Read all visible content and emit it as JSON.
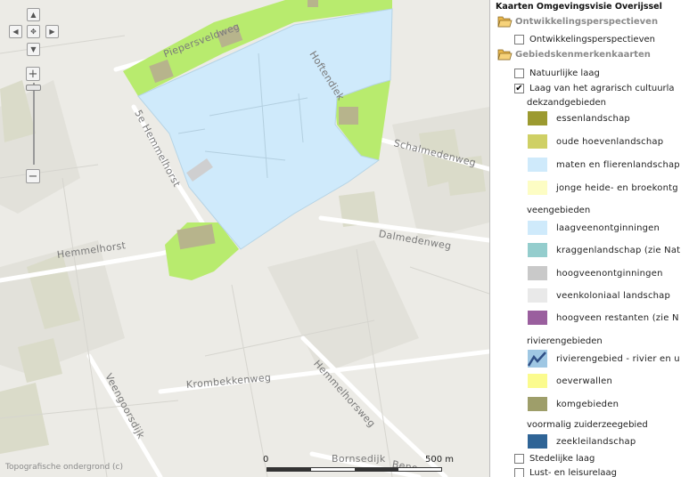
{
  "map": {
    "roads": {
      "pieperseveldweg": "Piepersveldweg",
      "hoftendiek": "Hoftendiek",
      "hemmelhorst5e": "5e Hemmelhorst",
      "schalmedenweg": "Schalmedenweg",
      "dalmedenweg": "Dalmedenweg",
      "hemmelhorst": "Hemmelhorst",
      "hemmelhorstweg": "Hemmelhorsweg",
      "krombekkenweg": "Krombekkenweg",
      "veengoorsdijk": "Veengoorsdijk",
      "bornsedijk": "Bornsedijk",
      "bornsedijk_cut": "Beno"
    },
    "scale": {
      "start": "0",
      "end": "500 m"
    },
    "copyright": "Topografische ondergrond (c)",
    "colors": {
      "maten": "#cfeafb",
      "oude_hoeven": "#b8eb6e",
      "farm": "#b7b48c",
      "background": "#ecebe6"
    }
  },
  "panel": {
    "title": "Kaarten Omgevingsvisie Overijssel",
    "folders": [
      {
        "label": "Ontwikkelingsperspectieven"
      },
      {
        "label": "Gebiedskenmerkenkaarten"
      }
    ],
    "layers": {
      "ontwikkelingsperspectieven": {
        "label": "Ontwikkelingsperspectieven",
        "checked": false
      },
      "natuurlijke_laag": {
        "label": "Natuurlijke laag",
        "checked": false
      },
      "agrarisch": {
        "label": "Laag van het agrarisch cultuurla",
        "checked": true
      },
      "stedelijke": {
        "label": "Stedelijke laag",
        "checked": false
      },
      "lust": {
        "label": "Lust- en leisurelaag",
        "checked": false
      }
    },
    "groups": {
      "dekzand": "dekzandgebieden",
      "veen": "veengebieden",
      "rivier": "rivierengebieden",
      "zuiderzee": "voormalig zuiderzeegebied"
    },
    "legend": [
      {
        "label": "essenlandschap",
        "color": "#9c9a30"
      },
      {
        "label": "oude hoevenlandschap",
        "color": "#cfd065"
      },
      {
        "label": "maten en flierenlandschap",
        "color": "#cfeafb"
      },
      {
        "label": "jonge heide- en broekontg",
        "color": "#fdfdc4"
      },
      {
        "label": "laagveenontginningen",
        "color": "#cfeafb"
      },
      {
        "label": "kraggenlandschap (zie Nat",
        "color": "#94cdcd"
      },
      {
        "label": "hoogveenontginningen",
        "color": "#c9c9c9"
      },
      {
        "label": "veenkoloniaal landschap",
        "color": "#e9e9e9"
      },
      {
        "label": "hoogveen restanten (zie N",
        "color": "#9a5f9e"
      },
      {
        "label": "rivierengebied - rivier en u",
        "color": "#9fc7e3",
        "icon": "river-line-icon"
      },
      {
        "label": "oeverwallen",
        "color": "#fbfb8e"
      },
      {
        "label": "komgebieden",
        "color": "#9e9e6a"
      },
      {
        "label": "zeekleilandschap",
        "color": "#2f6496"
      }
    ]
  }
}
